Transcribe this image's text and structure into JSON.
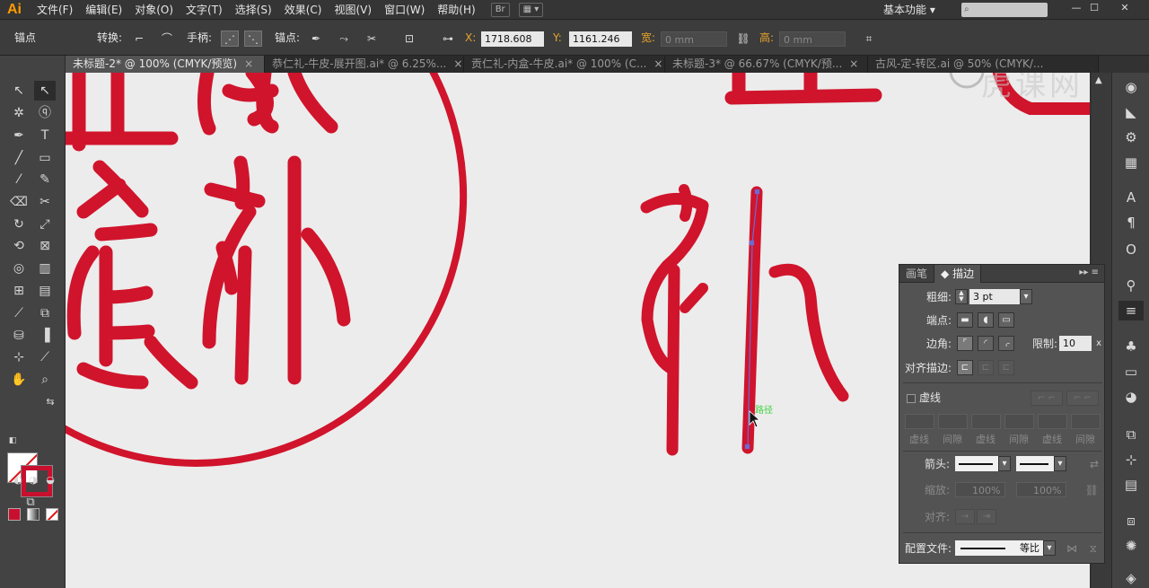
{
  "app": {
    "logo": "Ai"
  },
  "menu": [
    "文件(F)",
    "编辑(E)",
    "对象(O)",
    "文字(T)",
    "选择(S)",
    "效果(C)",
    "视图(V)",
    "窗口(W)",
    "帮助(H)"
  ],
  "menubar_extra": {
    "bridge": "Br",
    "workspace": "基本功能"
  },
  "watermark": "虎课网",
  "control": {
    "anchor_label": "锚点",
    "convert_label": "转换:",
    "handle_label": "手柄:",
    "anchor2_label": "锚点:",
    "x_label": "X:",
    "x_value": "1718.608",
    "y_label": "Y:",
    "y_value": "1161.246",
    "w_label": "宽:",
    "w_value": "0 mm",
    "h_label": "高:",
    "h_value": "0 mm"
  },
  "tabs": [
    {
      "label": "未标题-2* @ 100% (CMYK/预览)",
      "active": true
    },
    {
      "label": "恭仁礼-牛皮-展开图.ai* @ 6.25%..."
    },
    {
      "label": "贡仁礼-内盒-牛皮.ai* @ 100% (C..."
    },
    {
      "label": "未标题-3* @ 66.67% (CMYK/预..."
    },
    {
      "label": "古风-定-转区.ai @ 50% (CMYK/..."
    }
  ],
  "canvas": {
    "path_hint": "路径",
    "accent": "#d0142c",
    "bg": "#ececec"
  },
  "panel": {
    "tab_brush": "画笔",
    "tab_stroke": "描边",
    "weight_label": "粗细:",
    "weight_value": "3 pt",
    "cap_label": "端点:",
    "corner_label": "边角:",
    "limit_label": "限制:",
    "limit_value": "10",
    "limit_unit": "x",
    "align_label": "对齐描边:",
    "dashed_label": "虚线",
    "dash_labels": [
      "虚线",
      "间隙",
      "虚线",
      "间隙",
      "虚线",
      "间隙"
    ],
    "arrow_label": "箭头:",
    "scale_label": "缩放:",
    "scale_value1": "100%",
    "scale_value2": "100%",
    "align2_label": "对齐:",
    "profile_label": "配置文件:",
    "profile_value": "等比"
  }
}
